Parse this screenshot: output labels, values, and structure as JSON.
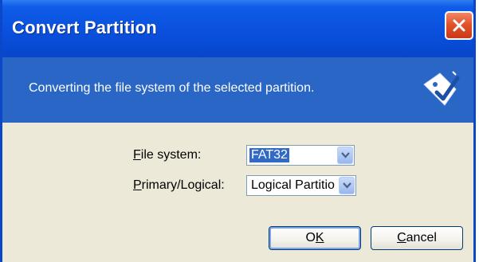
{
  "window": {
    "title": "Convert Partition"
  },
  "header": {
    "description": "Converting the file system of the selected partition."
  },
  "form": {
    "file_system": {
      "label_accel": "F",
      "label_rest": "ile system:",
      "value": "FAT32"
    },
    "primary_logical": {
      "label_accel": "P",
      "label_rest": "rimary/Logical:",
      "value": "Logical Partitio"
    }
  },
  "buttons": {
    "ok_pre": "O",
    "ok_accel": "K",
    "cancel_accel": "C",
    "cancel_rest": "ancel"
  },
  "icons": {
    "close": "close-icon",
    "wizard": "wizard-badge-icon",
    "dropdown": "chevron-down-icon"
  },
  "colors": {
    "titlebar": "#0a50dd",
    "header": "#2a66c6",
    "dialog_bg": "#ece9d8",
    "close_button": "#e2532c",
    "selection": "#316ac5"
  }
}
